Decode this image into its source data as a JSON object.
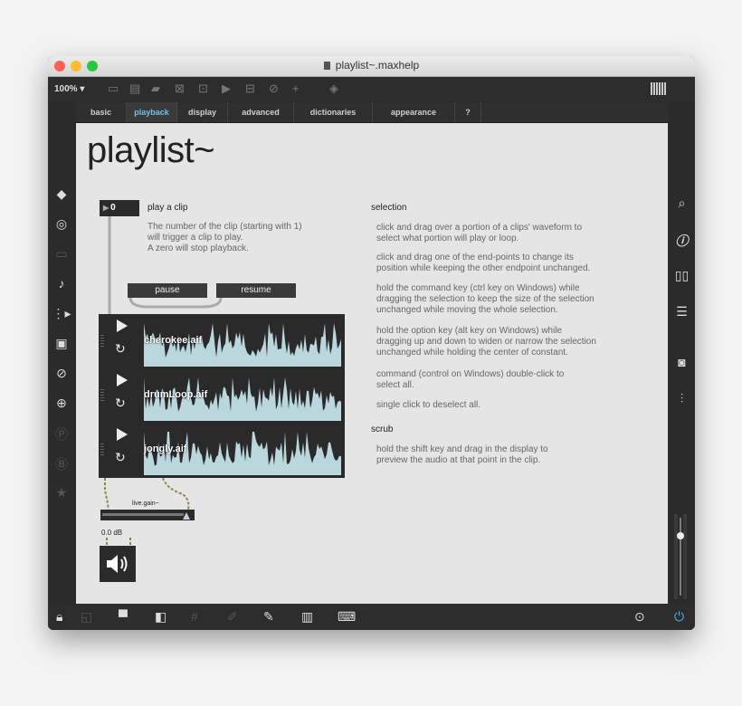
{
  "window": {
    "title": "playlist~.maxhelp",
    "traffic_colors": [
      "#fe5f57",
      "#febc2e",
      "#28c840"
    ]
  },
  "toolbar": {
    "zoom": "100%",
    "icons": [
      "presentation-icon",
      "comment-icon",
      "chat-icon",
      "box-icon",
      "object-icon",
      "message-icon",
      "toggle-icon",
      "help-icon",
      "plus-icon",
      "paint-bucket-icon"
    ],
    "grid_icon": "grid-icon"
  },
  "tabs": [
    {
      "label": "basic",
      "active": false
    },
    {
      "label": "playback",
      "active": true
    },
    {
      "label": "display",
      "active": false
    },
    {
      "label": "advanced",
      "active": false
    },
    {
      "label": "dictionaries",
      "active": false
    },
    {
      "label": "appearance",
      "active": false
    },
    {
      "label": "?",
      "active": false
    }
  ],
  "accent_color": "#6fc3e8",
  "patch": {
    "title": "playlist~",
    "number_box_value": "0",
    "play_clip": {
      "label": "play a clip",
      "desc": [
        "The number of the clip (starting with 1)",
        "will trigger a clip to play.",
        "A zero will stop playback."
      ]
    },
    "buttons": {
      "pause": "pause",
      "resume": "resume"
    },
    "clips": [
      {
        "name": "cherokee.aif"
      },
      {
        "name": "drumLoop.aif"
      },
      {
        "name": "jongly.aif"
      }
    ],
    "wave_color": "#b9d7dc",
    "gain": {
      "label": "live.gain~",
      "db": "0.0 dB"
    },
    "selection": {
      "heading": "selection",
      "paras": [
        [
          "click and drag over a portion of a clips' waveform to",
          "select what portion will play or loop."
        ],
        [
          "click and drag one of the end-points to change its",
          "position while keeping the other endpoint unchanged."
        ],
        [
          "hold the command key (ctrl key on Windows) while",
          "dragging the selection to keep the size of the selection",
          "unchanged while moving the whole selection."
        ],
        [
          "hold the option key (alt key on Windows) while",
          "dragging up and down to widen or narrow the selection",
          "unchanged while holding the center of constant."
        ],
        [
          "command (control on Windows) double-click to",
          "select all."
        ],
        [
          "single click to deselect all."
        ]
      ]
    },
    "scrub": {
      "heading": "scrub",
      "desc": [
        "hold the shift key and drag in the display to",
        "preview the audio at that point in the clip."
      ]
    }
  },
  "sidebar_left": [
    "cube-icon",
    "target-icon",
    "keyboard-icon",
    "note-icon",
    "sequence-icon",
    "image-icon",
    "paperclip-icon",
    "plug-icon",
    "p-icon",
    "b-icon",
    "star-icon"
  ],
  "sidebar_right": [
    "search-icon",
    "info-icon",
    "book-icon",
    "list-icon",
    "camera-icon",
    "mixer-icon"
  ],
  "bottombar": [
    "lock-icon",
    "presentation-mode-icon",
    "comment-box-icon",
    "windows-icon",
    "grid-icon",
    "debug-icon",
    "wrench-icon",
    "piano-icon",
    "computer-keyboard-icon",
    "transport-icon",
    "power-icon"
  ]
}
